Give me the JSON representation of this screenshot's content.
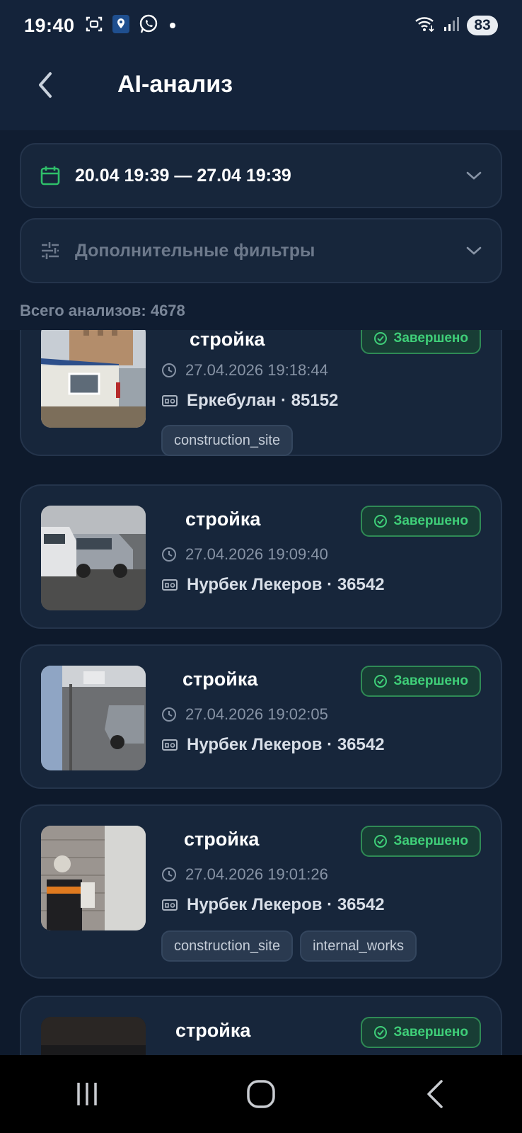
{
  "status_bar": {
    "time": "19:40",
    "battery": "83",
    "left_icons": [
      "screenshot-icon",
      "location-app-icon",
      "whatsapp-icon",
      "notification-dot-icon"
    ],
    "right_icons": [
      "wifi-icon",
      "signal-icon"
    ]
  },
  "app_bar": {
    "title": "AI-анализ",
    "back_icon": "chevron-left-icon"
  },
  "filters": {
    "date_range": "20.04 19:39 — 27.04 19:39",
    "additional_filters": "Дополнительные фильтры",
    "total": "Всего анализов: 4678"
  },
  "colors": {
    "background": "#0e1a2c",
    "card": "#17263b",
    "accent_green": "#3fcf79",
    "calendar_green": "#2fbf6a",
    "muted_text": "#7a8698"
  },
  "cards": [
    {
      "title": "стройка",
      "status": "Завершено",
      "datetime": "27.04.2026 19:18:44",
      "user": "Еркебулан  · 85152",
      "tags": [
        "construction_site"
      ],
      "thumb": "building-photo"
    },
    {
      "title": "стройка",
      "status": "Завершено",
      "datetime": "27.04.2026 19:09:40",
      "user": "Нурбек Лекеров · 36542",
      "tags": [],
      "thumb": "cars-photo"
    },
    {
      "title": "стройка",
      "status": "Завершено",
      "datetime": "27.04.2026 19:02:05",
      "user": "Нурбек Лекеров · 36542",
      "tags": [],
      "thumb": "street-photo"
    },
    {
      "title": "стройка",
      "status": "Завершено",
      "datetime": "27.04.2026 19:01:26",
      "user": "Нурбек Лекеров · 36542",
      "tags": [
        "construction_site",
        "internal_works"
      ],
      "thumb": "worker-photo"
    },
    {
      "title": "стройка",
      "status": "Завершено",
      "thumb": "dark-photo"
    }
  ],
  "nav_bar": {
    "buttons": [
      "recent-apps-icon",
      "home-icon",
      "back-icon"
    ]
  }
}
